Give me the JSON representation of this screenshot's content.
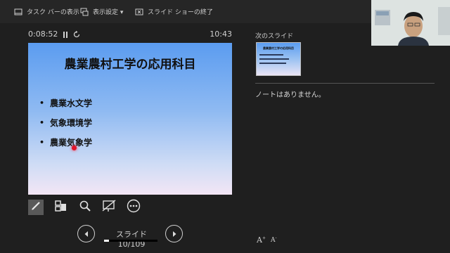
{
  "toolbar": {
    "taskbar_label": "タスク バーの表示",
    "display_settings_label": "表示設定 ▾",
    "end_show_label": "スライド ショーの終了"
  },
  "timer": {
    "elapsed": "0:08:52",
    "clock": "10:43"
  },
  "slide": {
    "title": "農業農村工学の応用科目",
    "bullets": [
      "農業水文学",
      "気象環境学",
      "農業気象学"
    ]
  },
  "navigation": {
    "counter": "スライド 10/109",
    "progress": 0.0917
  },
  "right_panel": {
    "next_slide_label": "次のスライド",
    "next_slide_title": "農業農村工学の応用科目",
    "notes_text": "ノートはありません。"
  },
  "colors": {
    "background": "#1f1f1f",
    "laser": "#e0152b",
    "slide_top": "#5b9cf0"
  },
  "icons": [
    "taskbar-icon",
    "display-settings-icon",
    "end-show-icon",
    "pause-icon",
    "reset-icon",
    "pen-icon",
    "see-all-slides-icon",
    "zoom-icon",
    "subtitles-icon",
    "more-options-icon",
    "previous-icon",
    "next-icon"
  ]
}
